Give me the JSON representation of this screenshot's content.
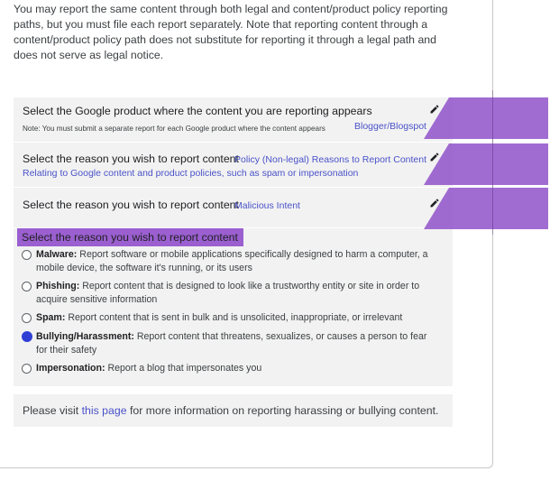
{
  "intro": {
    "text": "You may report the same content through both legal and content/product policy reporting paths, but you must file each report separately. Note that reporting content through a content/product policy path does not substitute for reporting it through a legal path and does not serve as legal notice."
  },
  "steps": [
    {
      "title": "Select the Google product where the content you are reporting appears",
      "note": "Note: You must submit a separate report for each Google product where the content appears",
      "value": "Blogger/Blogspot",
      "edit_icon": "pencil-icon"
    },
    {
      "title": "Select the reason you wish to report content",
      "value": "Policy (Non-legal) Reasons to Report Content",
      "value_detail": "Relating to Google content and product policies, such as spam or impersonation",
      "edit_icon": "pencil-icon"
    },
    {
      "title": "Select the reason you wish to report content",
      "value": "Malicious Intent",
      "edit_icon": "pencil-icon"
    }
  ],
  "question": {
    "title": "Select the reason you wish to report content",
    "options": [
      {
        "label": "Malware:",
        "desc": "Report software or mobile applications specifically designed to harm a computer, a mobile device, the software it's running, or its users",
        "checked": false
      },
      {
        "label": "Phishing:",
        "desc": "Report content that is designed to look like a trustworthy entity or site in order to acquire sensitive information",
        "checked": false
      },
      {
        "label": "Spam:",
        "desc": "Report content that is sent in bulk and is unsolicited, inappropriate, or irrelevant",
        "checked": false
      },
      {
        "label": "Bullying/Harassment:",
        "desc": "Report content that threatens, sexualizes, or causes a person to fear for their safety",
        "checked": true
      },
      {
        "label": "Impersonation:",
        "desc": "Report a blog that impersonates you",
        "checked": false
      }
    ]
  },
  "footer": {
    "prefix": "Please visit ",
    "link": "this page",
    "suffix": " for more information on reporting harassing or bullying content."
  },
  "colors": {
    "link": "#4a52c8",
    "radio_checked": "#2f3fd6",
    "overlay": "#9b5fd0",
    "panel_bg": "#f2f2f2"
  }
}
